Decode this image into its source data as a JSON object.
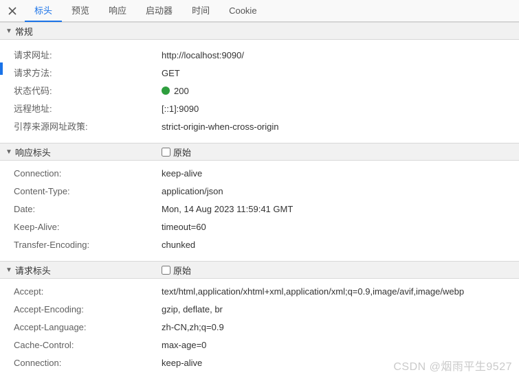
{
  "tabs": {
    "t0": "标头",
    "t1": "预览",
    "t2": "响应",
    "t3": "启动器",
    "t4": "时间",
    "t5": "Cookie"
  },
  "sections": {
    "general": "常规",
    "responseHeaders": "响应标头",
    "requestHeaders": "请求标头",
    "rawLabel": "原始"
  },
  "general": {
    "requestUrlLabel": "请求网址:",
    "requestUrlValue": "http://localhost:9090/",
    "methodLabel": "请求方法:",
    "methodValue": "GET",
    "statusLabel": "状态代码:",
    "statusValue": "200",
    "remoteLabel": "远程地址:",
    "remoteValue": "[::1]:9090",
    "referrerLabel": "引荐来源网址政策:",
    "referrerValue": "strict-origin-when-cross-origin"
  },
  "response": {
    "connectionLabel": "Connection:",
    "connectionValue": "keep-alive",
    "contentTypeLabel": "Content-Type:",
    "contentTypeValue": "application/json",
    "dateLabel": "Date:",
    "dateValue": "Mon, 14 Aug 2023 11:59:41 GMT",
    "keepAliveLabel": "Keep-Alive:",
    "keepAliveValue": "timeout=60",
    "transferLabel": "Transfer-Encoding:",
    "transferValue": "chunked"
  },
  "request": {
    "acceptLabel": "Accept:",
    "acceptValue": "text/html,application/xhtml+xml,application/xml;q=0.9,image/avif,image/webp",
    "acceptEncLabel": "Accept-Encoding:",
    "acceptEncValue": "gzip, deflate, br",
    "acceptLangLabel": "Accept-Language:",
    "acceptLangValue": "zh-CN,zh;q=0.9",
    "cacheLabel": "Cache-Control:",
    "cacheValue": "max-age=0",
    "connLabel": "Connection:",
    "connValue": "keep-alive"
  },
  "watermark": "CSDN @烟雨平生9527"
}
